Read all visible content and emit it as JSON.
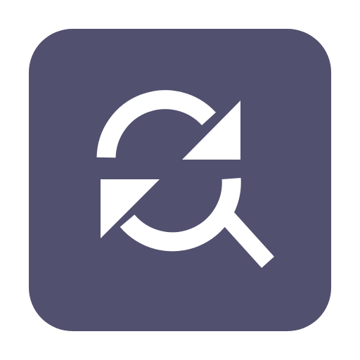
{
  "app_icon": {
    "icon": "refresh-search-icon",
    "background_color": "#51506f",
    "glyph_color": "#ffffff"
  }
}
